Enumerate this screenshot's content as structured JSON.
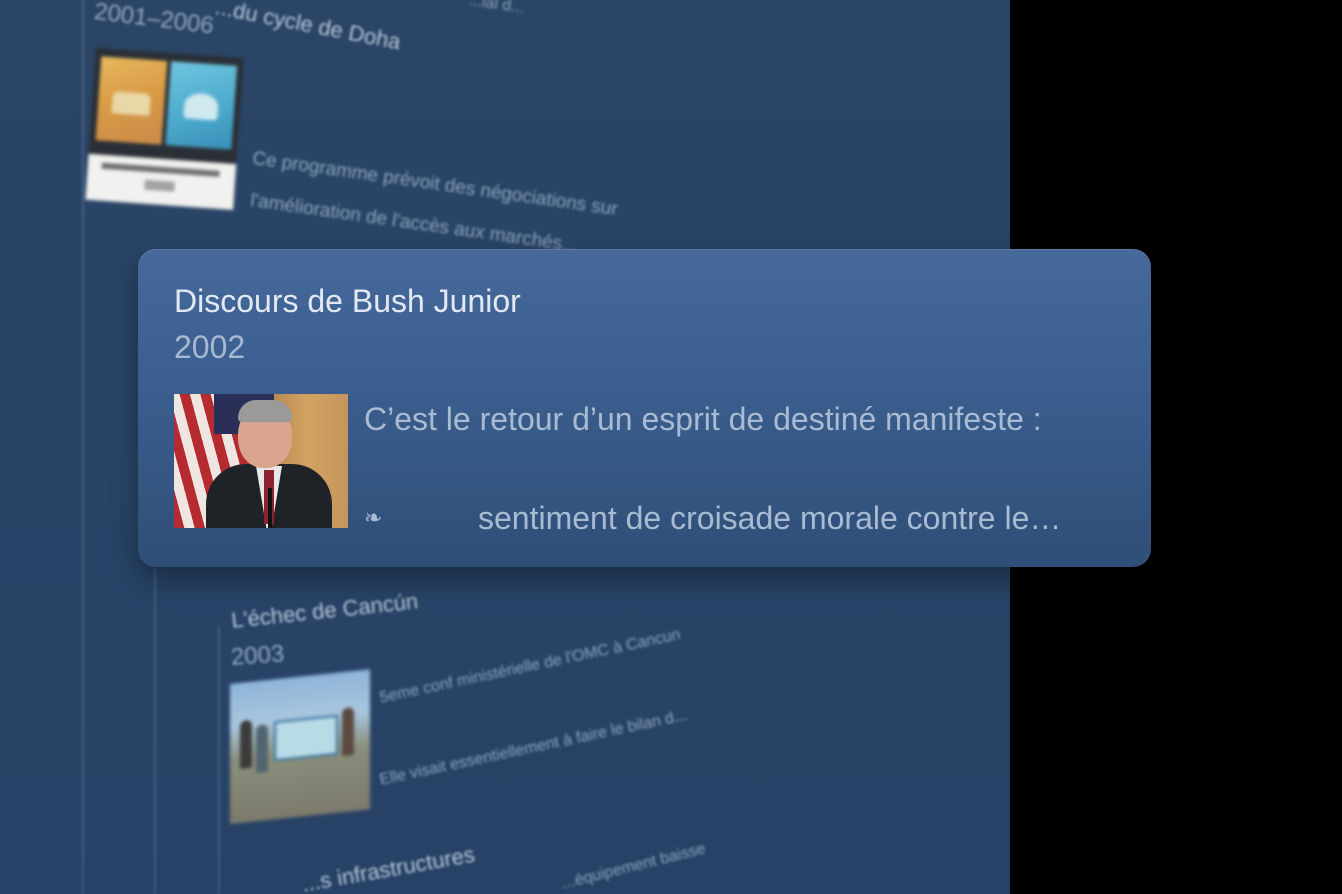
{
  "background_timeline": {
    "top_partial_text": "...ial d...",
    "doha": {
      "title": "...du cycle de Doha",
      "year": "2001–2006",
      "text_line1": "Ce programme prévoit des négociations sur",
      "text_line2": "l'amélioration de l'accès aux marchés..."
    },
    "cancun": {
      "title": "L'échec de Cancún",
      "year": "2003",
      "text_line1": "5eme conf ministérielle de l'OMC à Cancun",
      "text_line2": "Elle visait essentiellement à faire le bilan d..."
    },
    "infra": {
      "title": "...s infrastructures",
      "text_line1": "...équipement baisse"
    }
  },
  "popup": {
    "title": "Discours de Bush Junior",
    "year": "2002",
    "text_line1": "C’est le retour d’un esprit de destiné manifeste :",
    "glyph": "❧",
    "text_line2": "sentiment de croisade morale contre le…"
  },
  "colors": {
    "panel_bg": "#294467",
    "popup_bg": "#3d6092",
    "outer_bg": "#000000"
  }
}
